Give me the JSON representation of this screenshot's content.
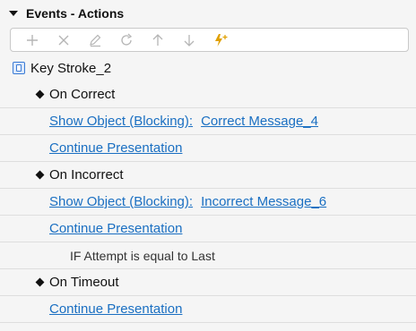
{
  "header": {
    "title": "Events - Actions"
  },
  "toolbar": {
    "buttons": [
      {
        "name": "add-icon",
        "color": "#b5b5b5"
      },
      {
        "name": "delete-icon",
        "color": "#b5b5b5"
      },
      {
        "name": "edit-icon",
        "color": "#b5b5b5"
      },
      {
        "name": "refresh-icon",
        "color": "#b5b5b5"
      },
      {
        "name": "move-up-icon",
        "color": "#b5b5b5"
      },
      {
        "name": "move-down-icon",
        "color": "#b5b5b5"
      },
      {
        "name": "add-event-icon",
        "color": "#e0a000"
      }
    ]
  },
  "tree": {
    "root": "Key Stroke_2",
    "events": [
      {
        "label": "On Correct",
        "actions": [
          {
            "action": "Show Object (Blocking):",
            "target": "Correct Message_4"
          },
          {
            "action": "Continue Presentation"
          }
        ]
      },
      {
        "label": "On Incorrect",
        "actions": [
          {
            "action": "Show Object (Blocking):",
            "target": "Incorrect Message_6"
          },
          {
            "action": "Continue Presentation"
          }
        ],
        "condition": "IF Attempt is equal to Last"
      },
      {
        "label": "On Timeout",
        "actions": [
          {
            "action": "Continue Presentation"
          }
        ]
      }
    ]
  },
  "colors": {
    "link": "#1a6fc2",
    "accent": "#e0a000",
    "background": "#f5f5f5"
  }
}
